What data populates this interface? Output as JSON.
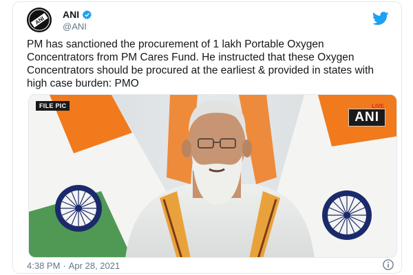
{
  "account": {
    "name": "ANI",
    "handle": "@ANI",
    "verified": true,
    "avatar_label": "ANI"
  },
  "tweet": {
    "text": "PM has sanctioned the procurement of 1 lakh Portable Oxygen Concentrators from PM Cares Fund. He instructed that these Oxygen Concentrators should be procured at the earliest & provided in states with high case burden: PMO"
  },
  "media": {
    "file_tag": "FILE PIC",
    "live_tag": "LIVE",
    "watermark": "ANI"
  },
  "footer": {
    "time": "4:38 PM",
    "separator": "·",
    "date": "Apr 28, 2021"
  },
  "icons": {
    "brand": "twitter-bird-icon",
    "verified": "verified-badge-icon",
    "info": "info-icon"
  },
  "colors": {
    "twitter_blue": "#1da1f2",
    "text": "#14171a",
    "muted": "#657786",
    "saffron": "#f07a1c",
    "flag_green": "#2e8b3a",
    "chakra_navy": "#1b2a6b"
  }
}
